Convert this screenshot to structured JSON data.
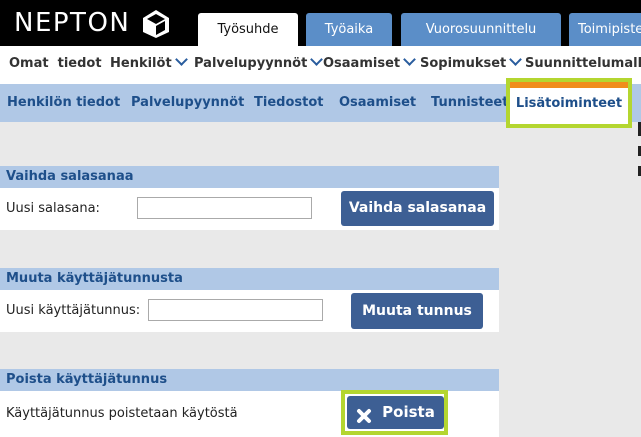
{
  "brand": {
    "logo_text": "NEPTON"
  },
  "top_tabs": [
    {
      "label": "Työsuhde",
      "active": true
    },
    {
      "label": "Työaika"
    },
    {
      "label": "Vuorosuunnittelu"
    },
    {
      "label": "Toimipiste"
    }
  ],
  "menu": [
    {
      "label": "Omat  tiedot"
    },
    {
      "label": "Henkilöt"
    },
    {
      "label": "Palvelupyynnöt"
    },
    {
      "label": "Osaamiset"
    },
    {
      "label": "Sopimukset"
    },
    {
      "label": "Suunnittelumallit"
    }
  ],
  "subnav": [
    {
      "label": "Henkilön tiedot"
    },
    {
      "label": "Palvelupyynnöt"
    },
    {
      "label": "Tiedostot"
    },
    {
      "label": "Osaamiset"
    },
    {
      "label": "Tunnisteet"
    },
    {
      "label": "Lisätoiminteet",
      "active": true
    }
  ],
  "sections": {
    "password": {
      "title": "Vaihda salasanaa",
      "label": "Uusi salasana:",
      "value": "",
      "button": "Vaihda salasanaa"
    },
    "username": {
      "title": "Muuta käyttäjätunnusta",
      "label": "Uusi käyttäjätunnus:",
      "value": "",
      "button": "Muuta tunnus"
    },
    "delete": {
      "title": "Poista käyttäjätunnus",
      "label": "Käyttäjätunnus poistetaan käytöstä",
      "button": "Poista"
    }
  },
  "colors": {
    "accent": "#f08c1c",
    "highlight": "#b4d630",
    "button": "#3d5f94",
    "nav": "#b0c8e6"
  }
}
